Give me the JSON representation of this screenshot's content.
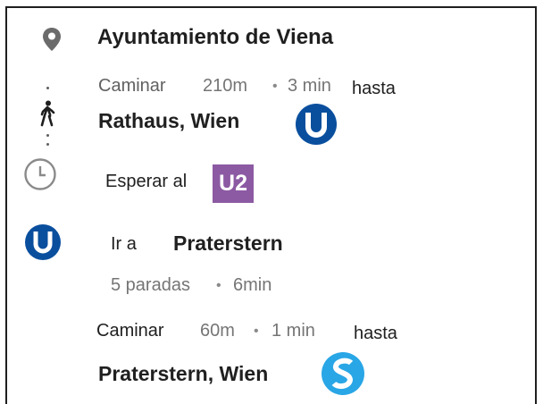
{
  "origin": {
    "name": "Ayuntamiento de Viena",
    "icon": "location-pin-icon"
  },
  "walk1": {
    "mode": "Caminar",
    "distance": "210m",
    "separator": "•",
    "duration": "3 min",
    "to_label": "hasta",
    "station": "Rathaus, Wien",
    "icon": "walking-person-icon"
  },
  "wait": {
    "label": "Esperar al",
    "line": "U2",
    "line_color": "#8c5aa3",
    "icon": "clock-icon"
  },
  "ride": {
    "label": "Ir a",
    "station": "Praterstern",
    "stops": "5 paradas",
    "separator": "•",
    "duration": "6min",
    "icon": "u-bahn-icon"
  },
  "walk2": {
    "mode": "Caminar",
    "distance": "60m",
    "separator": "•",
    "duration": "1 min",
    "to_label": "hasta",
    "station": "Praterstern, Wien",
    "icon": "s-bahn-icon"
  },
  "colors": {
    "ubahn_blue": "#0a4f9e",
    "sbahn_blue": "#29a6e6",
    "icon_gray": "#6b6b6b"
  }
}
